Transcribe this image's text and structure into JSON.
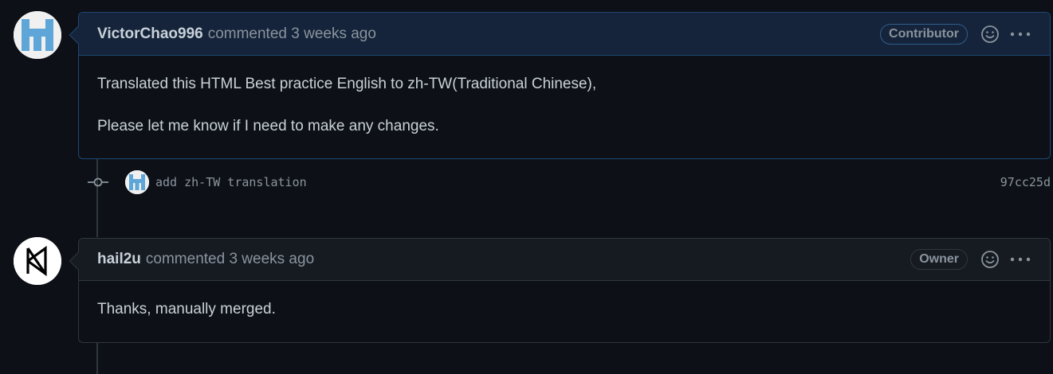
{
  "comments": [
    {
      "author": "VictorChao996",
      "meta": "commented 3 weeks ago",
      "role": "Contributor",
      "body": [
        "Translated this HTML Best practice English to zh-TW(Traditional Chinese),",
        "Please let me know if I need to make any changes."
      ]
    },
    {
      "author": "hail2u",
      "meta": "commented 3 weeks ago",
      "role": "Owner",
      "body": [
        "Thanks, manually merged."
      ]
    }
  ],
  "commit": {
    "message": "add zh-TW translation",
    "sha": "97cc25d"
  },
  "colors": {
    "background": "#0d1117",
    "highlight_header": "#15243a",
    "highlight_border": "#1f4774",
    "default_header": "#161b22",
    "border": "#30363d",
    "text": "#c9d1d9",
    "muted": "#8b949e"
  },
  "icons": {
    "emoji": "smiley-icon",
    "more": "kebab-horizontal-icon",
    "commit": "git-commit-icon"
  }
}
